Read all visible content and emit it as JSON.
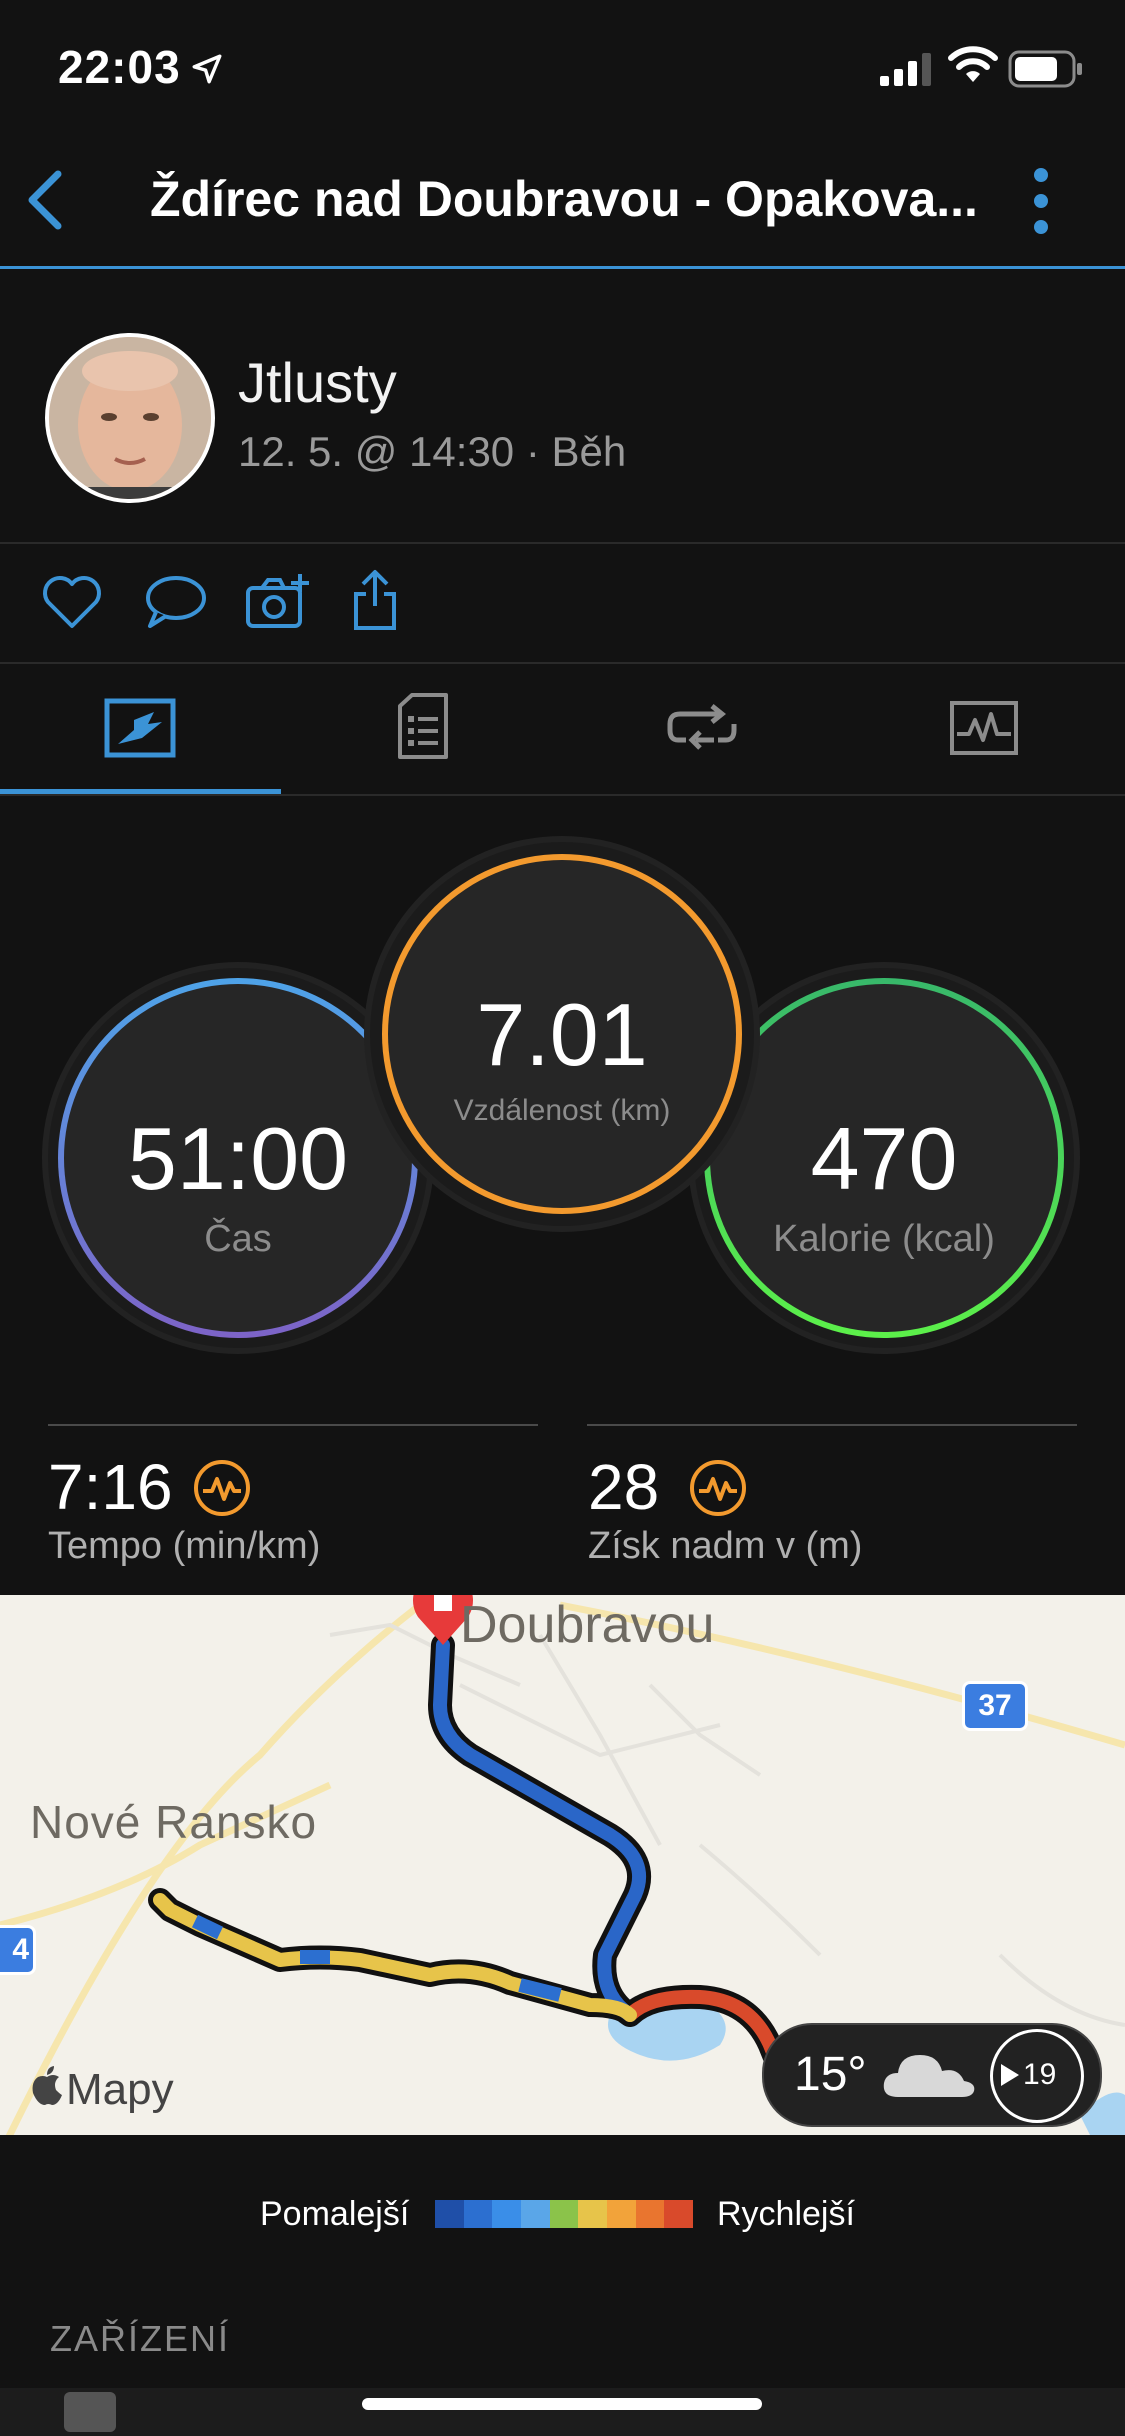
{
  "status": {
    "time": "22:03"
  },
  "nav": {
    "title": "Ždírec nad Doubravou - Opakova..."
  },
  "profile": {
    "name": "Jtlusty",
    "meta": "12. 5. @ 14:30 · Běh"
  },
  "tabs": [
    {
      "icon": "overview-icon"
    },
    {
      "icon": "details-icon"
    },
    {
      "icon": "laps-icon"
    },
    {
      "icon": "charts-icon"
    }
  ],
  "stats": {
    "time": {
      "value": "51:00",
      "label": "Čas"
    },
    "distance": {
      "value": "7.01",
      "label": "Vzdálenost (km)"
    },
    "calories": {
      "value": "470",
      "label": "Kalorie (kcal)"
    }
  },
  "metrics": {
    "pace": {
      "value": "7:16",
      "label": "Tempo (min/km)"
    },
    "elevation": {
      "value": "28",
      "label": "Získ nadm v (m)"
    }
  },
  "map": {
    "town_label": "Doubravou",
    "village_label": "Nové Ransko",
    "road_badge": "37",
    "road_badge_left": "4",
    "attribution": "Mapy",
    "weather_temp": "15°",
    "wind_speed": "19"
  },
  "legend": {
    "slow": "Pomalejší",
    "fast": "Rychlejší",
    "colors": [
      "#1f4fa8",
      "#2c6fd0",
      "#3a8ee8",
      "#5aa6e8",
      "#8bc34a",
      "#e7c44a",
      "#f2a33a",
      "#e9752f",
      "#d94a2b"
    ]
  },
  "section": {
    "device": "ZAŘÍZENÍ"
  },
  "colors": {
    "accent": "#3b93d6",
    "orange": "#f39a2e",
    "green": "#4cd964"
  }
}
